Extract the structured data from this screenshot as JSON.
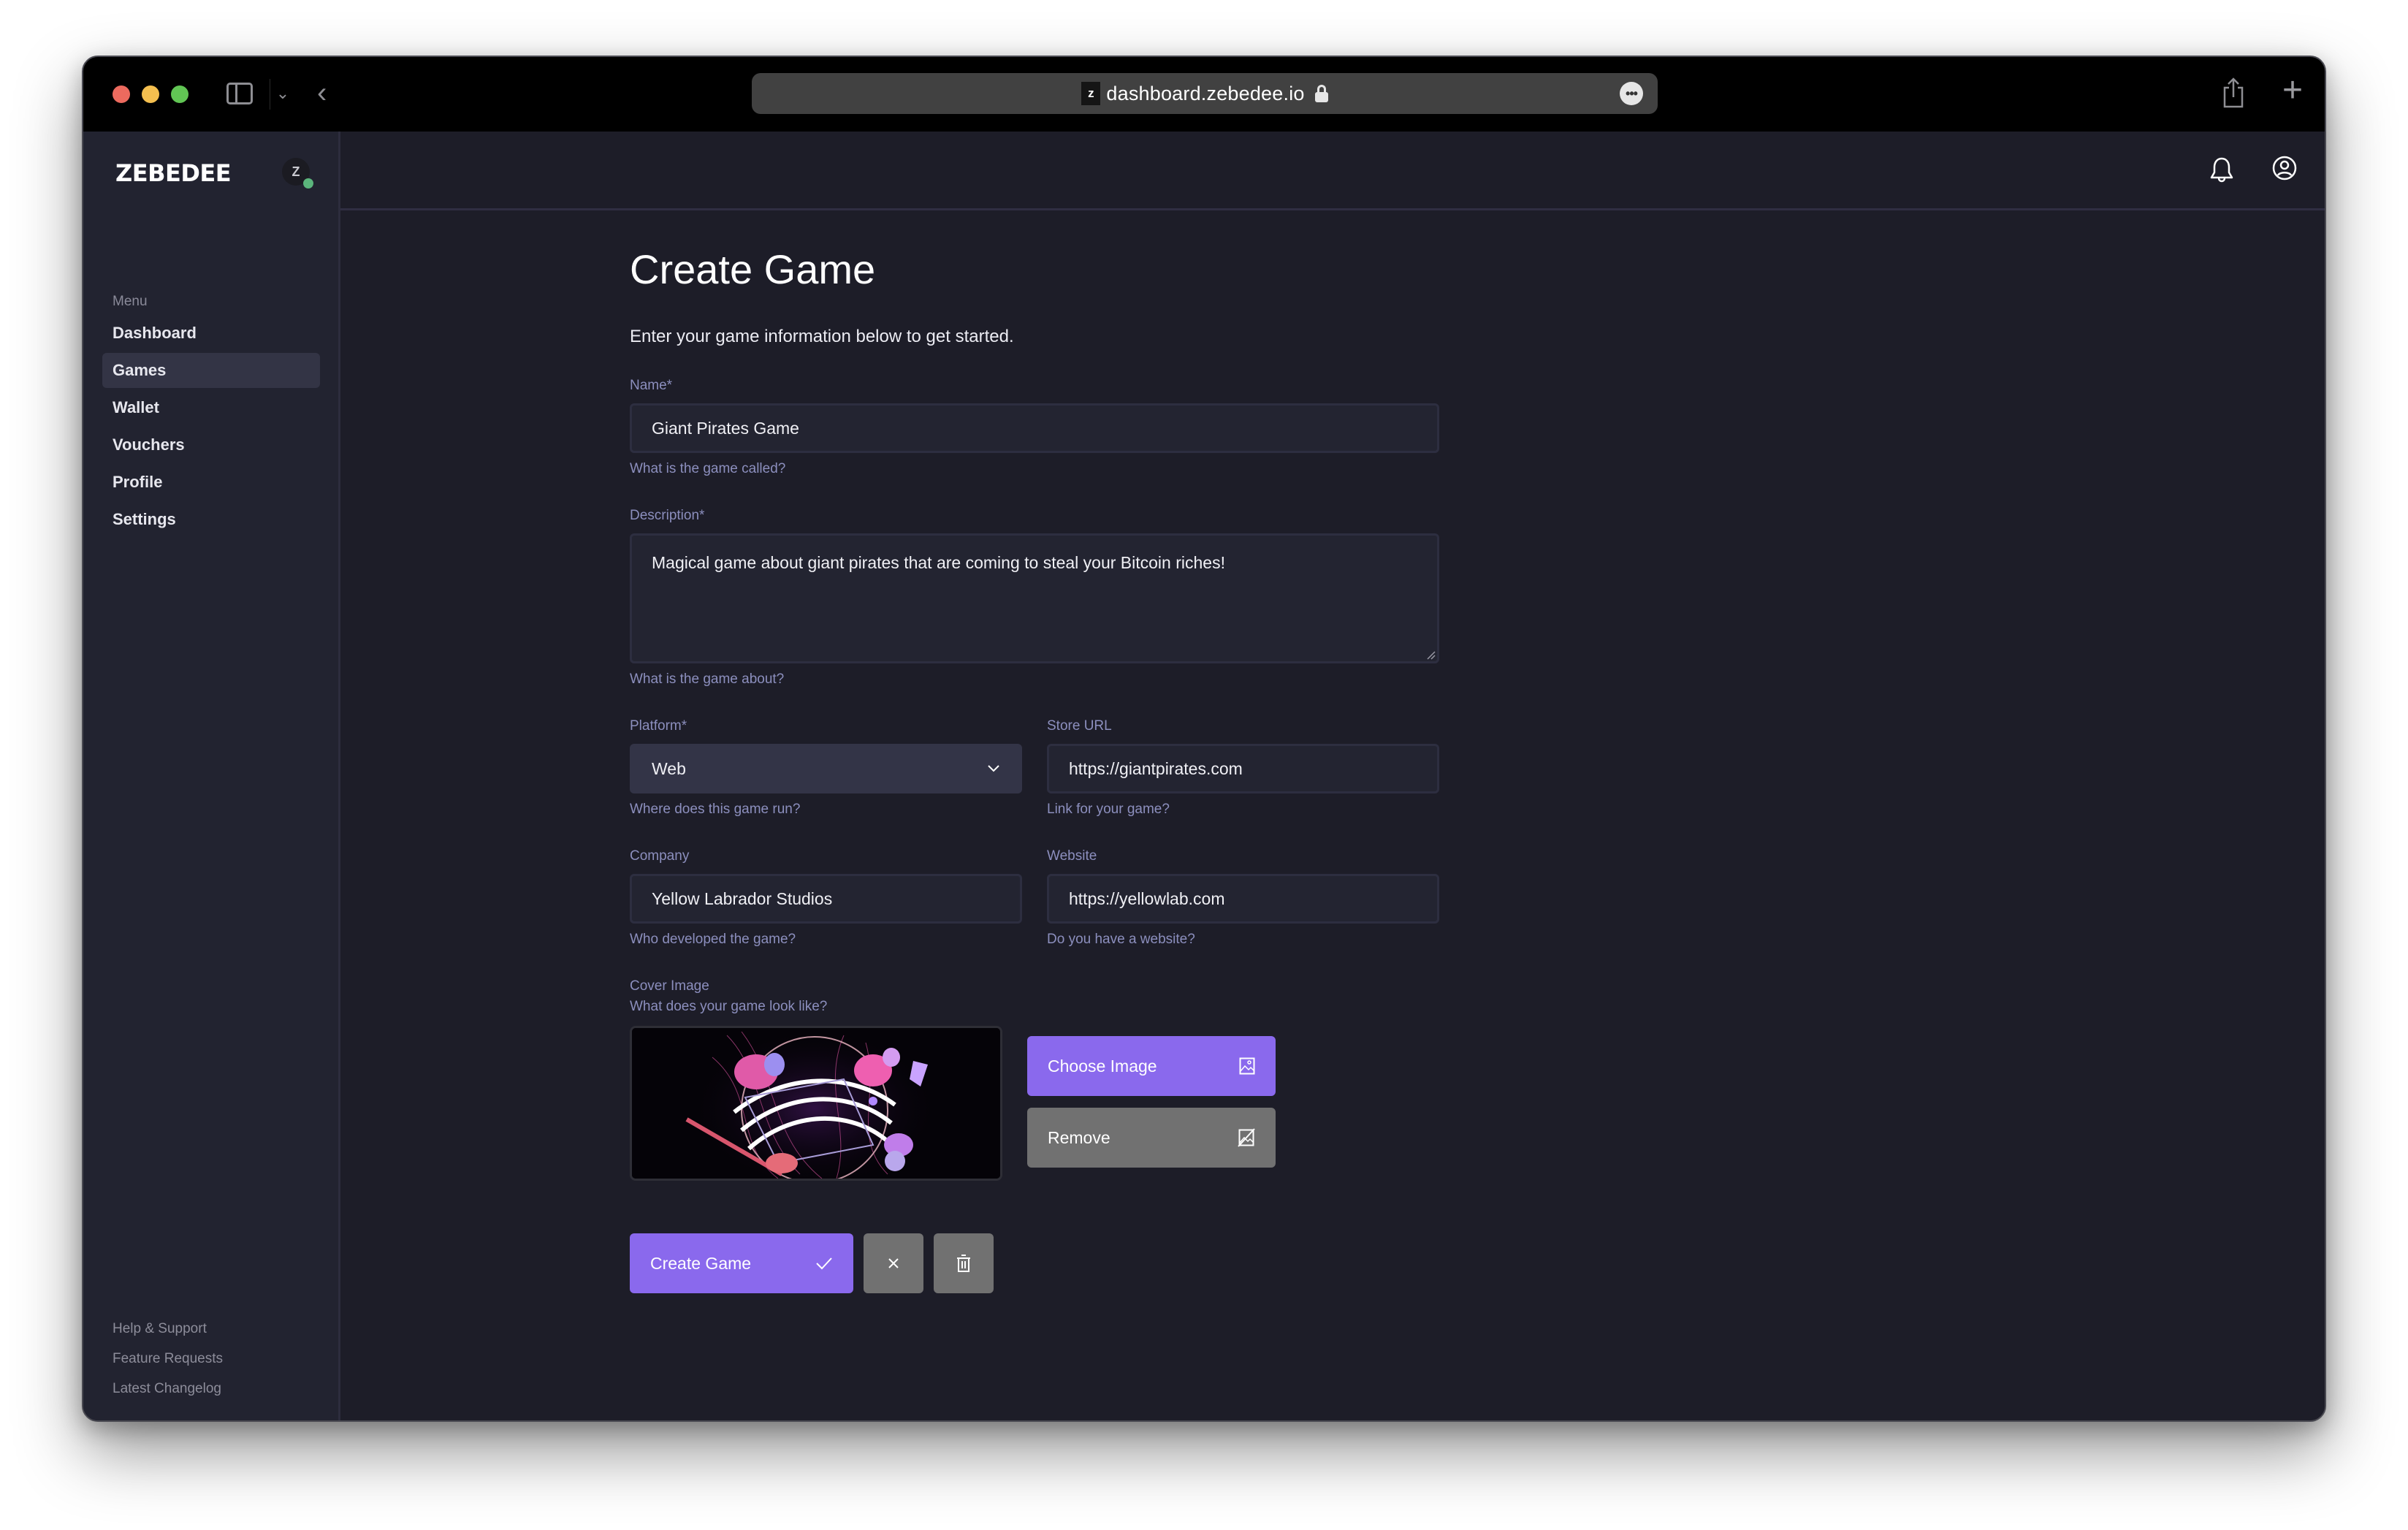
{
  "browser": {
    "url": "dashboard.zebedee.io",
    "favicon_letter": "z",
    "icons": [
      "sidebar-toggle-icon",
      "chevron-down-icon",
      "back-icon",
      "lock-icon",
      "more-icon",
      "share-icon",
      "new-tab-icon"
    ]
  },
  "sidebar": {
    "logo": "ZEBEDEE",
    "avatar_letter": "Z",
    "avatar_status_color": "#5bb57c",
    "menu_label": "Menu",
    "items": [
      {
        "label": "Dashboard",
        "active": false
      },
      {
        "label": "Games",
        "active": true
      },
      {
        "label": "Wallet",
        "active": false
      },
      {
        "label": "Vouchers",
        "active": false
      },
      {
        "label": "Profile",
        "active": false
      },
      {
        "label": "Settings",
        "active": false
      }
    ],
    "footer_links": [
      "Help & Support",
      "Feature Requests",
      "Latest Changelog"
    ]
  },
  "header": {
    "icons": [
      "bell-icon",
      "user-circle-icon"
    ]
  },
  "page": {
    "title": "Create Game",
    "intro": "Enter your game information below to get started."
  },
  "form": {
    "name": {
      "label": "Name*",
      "value": "Giant Pirates Game",
      "help": "What is the game called?"
    },
    "description": {
      "label": "Description*",
      "value": "Magical game about giant pirates that are coming to steal your Bitcoin riches!",
      "help": "What is the game about?"
    },
    "platform": {
      "label": "Platform*",
      "value": "Web",
      "help": "Where does this game run?"
    },
    "store_url": {
      "label": "Store URL",
      "value": "https://giantpirates.com",
      "help": "Link for your game?"
    },
    "company": {
      "label": "Company",
      "value": "Yellow Labrador Studios",
      "help": "Who developed the game?"
    },
    "website": {
      "label": "Website",
      "value": "https://yellowlab.com",
      "help": "Do you have a website?"
    },
    "cover": {
      "label": "Cover Image",
      "help": "What does your game look like?",
      "choose_label": "Choose Image",
      "remove_label": "Remove"
    }
  },
  "actions": {
    "create_label": "Create Game",
    "cancel_icon": "close-icon",
    "delete_icon": "trash-icon"
  },
  "colors": {
    "accent": "#8a69ed",
    "secondary_button": "#717171",
    "background": "#1d1d28",
    "sidebar": "#222330",
    "help_text": "#8c8fbe"
  }
}
